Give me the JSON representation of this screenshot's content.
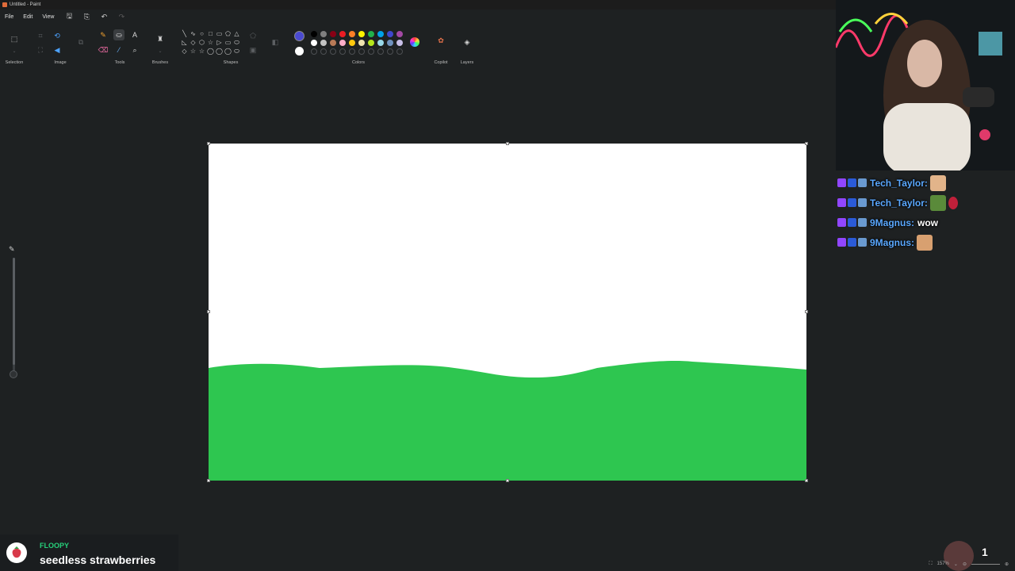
{
  "window": {
    "title": "Untitled - Paint"
  },
  "menu": {
    "file": "File",
    "edit": "Edit",
    "view": "View"
  },
  "ribbon": {
    "groups": {
      "selection": "Selection",
      "image": "Image",
      "tools": "Tools",
      "brushes": "Brushes",
      "shapes": "Shapes",
      "colors": "Colors",
      "copilot": "Copilot",
      "layers": "Layers"
    },
    "shape_glyphs": [
      "╲",
      "∿",
      "○",
      "□",
      "▭",
      "⬠",
      "△",
      "◺",
      "◇",
      "⬡",
      "☆",
      "▷",
      "▭",
      "⬭",
      "◇",
      "☆",
      "☆",
      "◯",
      "◯",
      "◯",
      "⬭"
    ],
    "primary_color": "#4a4ad0",
    "secondary_color": "#ffffff",
    "palette_row1": [
      "#000000",
      "#7f7f7f",
      "#880015",
      "#ed1c24",
      "#ff7f27",
      "#fff200",
      "#22b14c",
      "#00a2e8",
      "#3f48cc",
      "#a349a4"
    ],
    "palette_row2": [
      "#ffffff",
      "#c3c3c3",
      "#b97a57",
      "#ffaec9",
      "#ffc90e",
      "#efe4b0",
      "#b5e61d",
      "#99d9ea",
      "#7092be",
      "#c8bfe7"
    ]
  },
  "canvas": {
    "background": "#ffffff",
    "fill_color": "#2ec650"
  },
  "brush_size_slider": {
    "value": 0.9
  },
  "chat": [
    {
      "user": "Tech_Taylor:",
      "message": "",
      "emote": "hand-emote",
      "emote_color": "#e2b48a"
    },
    {
      "user": "Tech_Taylor:",
      "message": "",
      "emote": "pepe-emote",
      "emote_color": "#5a8a3a",
      "extra": "rose-emote"
    },
    {
      "user": "9Magnus:",
      "message": "wow",
      "emote": "",
      "emote_color": ""
    },
    {
      "user": "9Magnus:",
      "message": "",
      "emote": "face-emote",
      "emote_color": "#d8a070"
    }
  ],
  "now_playing": {
    "artist": "FLOOPY",
    "song": "seedless strawberries"
  },
  "counter": "1",
  "statusbar": {
    "zoom": "157%"
  }
}
